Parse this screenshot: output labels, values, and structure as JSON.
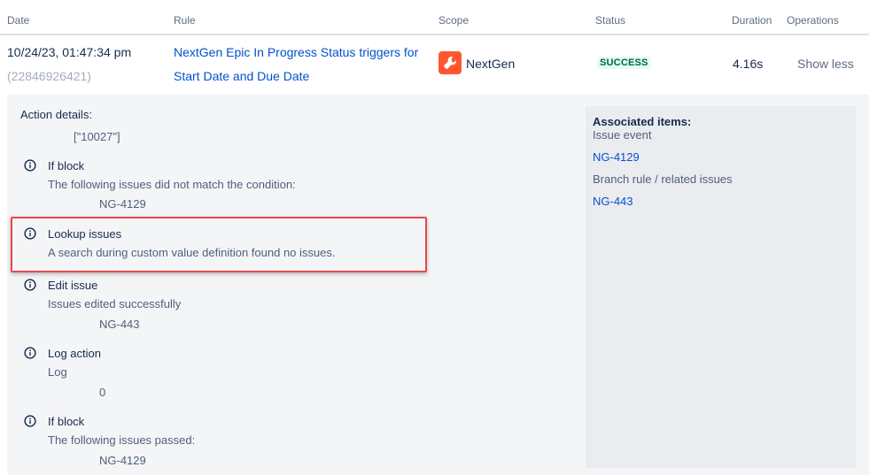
{
  "headers": {
    "date": "Date",
    "rule": "Rule",
    "scope": "Scope",
    "status": "Status",
    "duration": "Duration",
    "operations": "Operations"
  },
  "row": {
    "date": "10/24/23, 01:47:34 pm",
    "id": "(22846926421)",
    "rule_line1": "NextGen Epic In Progress Status triggers for",
    "rule_line2": "Start Date and Due Date",
    "scope_icon": "wrench-icon",
    "scope": "NextGen",
    "status": "SUCCESS",
    "duration": "4.16s",
    "operation": "Show less"
  },
  "details": {
    "title": "Action details:",
    "initial_value": "[\"10027\"]",
    "actions": [
      {
        "icon": "info-icon",
        "title": "If block",
        "message": "The following issues did not match the condition:",
        "value": "NG-4129"
      },
      {
        "icon": "info-icon",
        "title": "Lookup issues",
        "message": "A search during custom value definition found no issues."
      },
      {
        "icon": "info-icon",
        "title": "Edit issue",
        "message": "Issues edited successfully",
        "value": "NG-443"
      },
      {
        "icon": "info-icon",
        "title": "Log action",
        "message": "Log",
        "value": "0"
      },
      {
        "icon": "info-icon",
        "title": "If block",
        "message": "The following issues passed:",
        "value": "NG-4129"
      }
    ]
  },
  "associated": {
    "title": "Associated items:",
    "issue_event_label": "Issue event",
    "issue_event_link": "NG-4129",
    "branch_label": "Branch rule / related issues",
    "branch_link": "NG-443"
  },
  "colors": {
    "link": "#0052cc",
    "success_bg": "#e3fcef",
    "success_text": "#006644",
    "highlight": "#e5484d",
    "project_icon": "#ff5630"
  }
}
